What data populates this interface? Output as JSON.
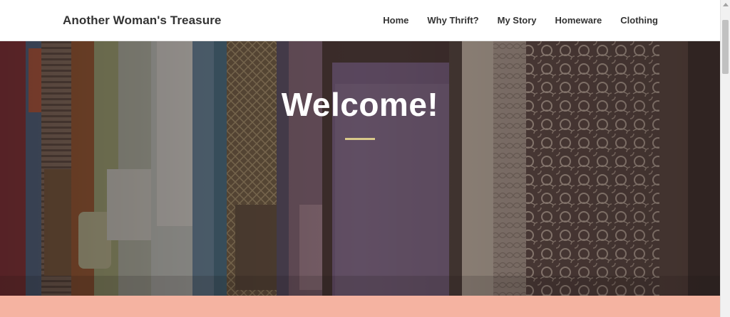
{
  "site": {
    "brand": "Another Woman's Treasure"
  },
  "nav": {
    "items": [
      {
        "label": "Home"
      },
      {
        "label": "Why Thrift?"
      },
      {
        "label": "My Story"
      },
      {
        "label": "Homeware"
      },
      {
        "label": "Clothing"
      }
    ]
  },
  "hero": {
    "title": "Welcome!",
    "divider_color": "#d9c98a",
    "image_icon": "clothes-rack-photo"
  },
  "colors": {
    "peach": "#f5b3a1",
    "nav_text": "#333333",
    "hero_text": "#ffffff"
  }
}
